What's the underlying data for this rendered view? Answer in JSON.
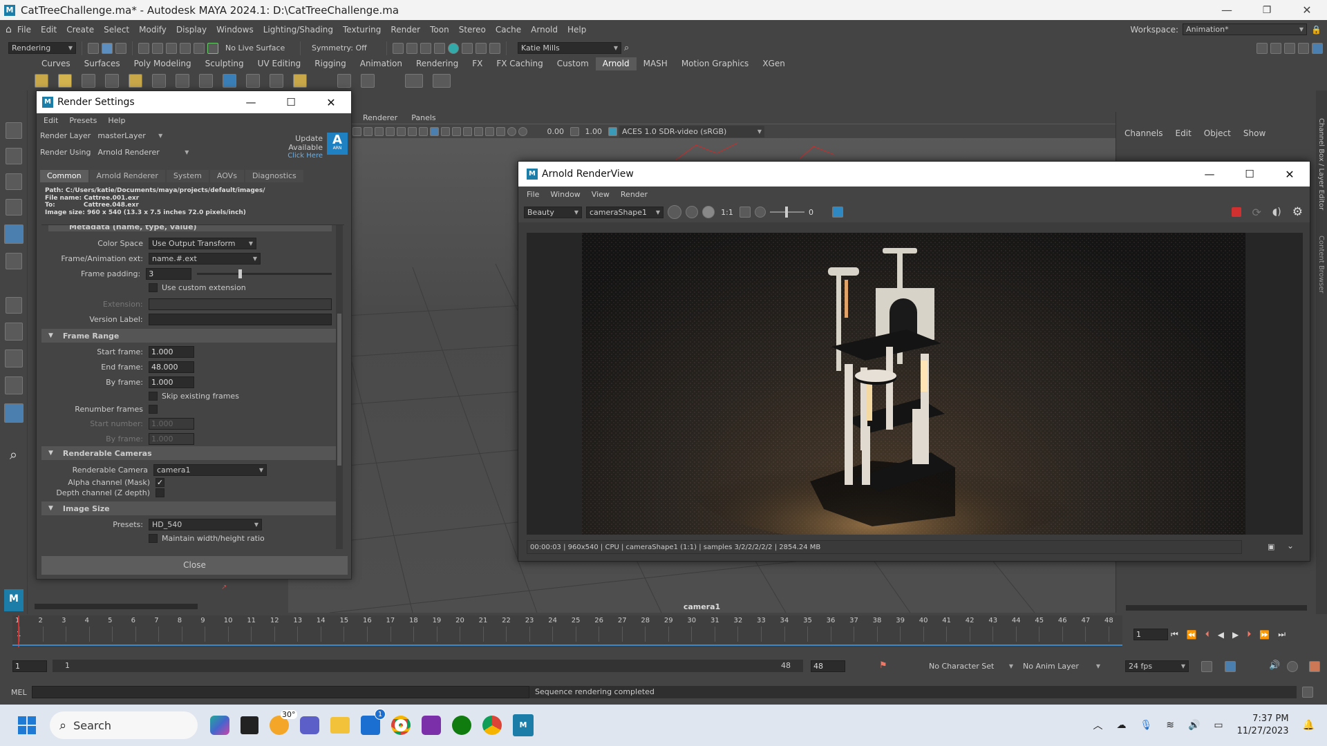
{
  "titlebar": {
    "title": "CatTreeChallenge.ma* - Autodesk MAYA 2024.1: D:\\CatTreeChallenge.ma"
  },
  "menubar": [
    "File",
    "Edit",
    "Create",
    "Select",
    "Modify",
    "Display",
    "Windows",
    "Lighting/Shading",
    "Texturing",
    "Render",
    "Toon",
    "Stereo",
    "Cache",
    "Arnold",
    "Help"
  ],
  "workspace": {
    "label": "Workspace:",
    "value": "Animation*"
  },
  "statusline": {
    "menuset": "Rendering",
    "live_surface": "No Live Surface",
    "symmetry": "Symmetry: Off",
    "user": "Katie Mills"
  },
  "shelf_tabs": [
    "Curves",
    "Surfaces",
    "Poly Modeling",
    "Sculpting",
    "UV Editing",
    "Rigging",
    "Animation",
    "Rendering",
    "FX",
    "FX Caching",
    "Custom",
    "Arnold",
    "MASH",
    "Motion Graphics",
    "XGen"
  ],
  "shelf_active": "Arnold",
  "viewport": {
    "menus": [
      "Renderer",
      "Panels"
    ],
    "val1": "0.00",
    "val2": "1.00",
    "colorspace": "ACES 1.0 SDR-video (sRGB)",
    "camera": "camera1"
  },
  "channelbox": {
    "menus": [
      "Channels",
      "Edit",
      "Object",
      "Show"
    ],
    "side1": "Channel Box / Layer Editor",
    "side2": "Content Browser"
  },
  "render_settings": {
    "title": "Render Settings",
    "menus": [
      "Edit",
      "Presets",
      "Help"
    ],
    "layer_label": "Render Layer",
    "layer": "masterLayer",
    "using_label": "Render Using",
    "using": "Arnold Renderer",
    "update": "Update Available",
    "click": "Click Here",
    "badge": "A",
    "badge_sub": "ARN",
    "tabs": [
      "Common",
      "Arnold Renderer",
      "System",
      "AOVs",
      "Diagnostics"
    ],
    "path": "Path: C:/Users/katie/Documents/maya/projects/default/images/",
    "filename_label": "File name:",
    "filename": "Cattree.001.exr",
    "to_label": "To:",
    "to": "Cattree.048.exr",
    "imagesize": "Image size: 960 x 540 (13.3 x 7.5 inches 72.0 pixels/inch)",
    "metadata": "Metadata (name, type, value)",
    "colorspace_label": "Color Space",
    "colorspace": "Use Output Transform",
    "frameext_label": "Frame/Animation ext:",
    "frameext": "name.#.ext",
    "padding_label": "Frame padding:",
    "padding": "3",
    "custom_ext": "Use custom extension",
    "extension_label": "Extension:",
    "version_label": "Version Label:",
    "frame_range": "Frame Range",
    "start_label": "Start frame:",
    "start": "1.000",
    "end_label": "End frame:",
    "end": "48.000",
    "by_label": "By frame:",
    "by": "1.000",
    "skip": "Skip existing frames",
    "renumber": "Renumber frames",
    "startnum_label": "Start number:",
    "startnum": "1.000",
    "by2_label": "By frame:",
    "by2": "1.000",
    "renderable_cameras": "Renderable Cameras",
    "cam_label": "Renderable Camera",
    "cam": "camera1",
    "alpha": "Alpha channel (Mask)",
    "depth": "Depth channel (Z depth)",
    "image_size": "Image Size",
    "presets_label": "Presets:",
    "presets": "HD_540",
    "maintain": "Maintain width/height ratio",
    "close": "Close"
  },
  "renderview": {
    "title": "Arnold RenderView",
    "menus": [
      "File",
      "Window",
      "View",
      "Render"
    ],
    "aov": "Beauty",
    "camera": "cameraShape1",
    "ratio": "1:1",
    "exposure": "0",
    "status": "00:00:03 | 960x540 | CPU | cameraShape1 (1:1) | samples 3/2/2/2/2/2 | 2854.24 MB"
  },
  "timeline": {
    "ticks": [
      "1",
      "2",
      "3",
      "4",
      "5",
      "6",
      "7",
      "8",
      "9",
      "10",
      "11",
      "12",
      "13",
      "14",
      "15",
      "16",
      "17",
      "18",
      "19",
      "20",
      "21",
      "22",
      "23",
      "24",
      "25",
      "26",
      "27",
      "28",
      "29",
      "30",
      "31",
      "32",
      "33",
      "34",
      "35",
      "36",
      "37",
      "38",
      "39",
      "40",
      "41",
      "42",
      "43",
      "44",
      "45",
      "46",
      "47",
      "48"
    ],
    "current": "1",
    "frame_field": "1"
  },
  "range": {
    "start": "1",
    "inner_start": "1",
    "inner_end": "48",
    "end": "48",
    "char_set": "No Character Set",
    "anim_layer": "No Anim Layer",
    "fps": "24 fps"
  },
  "cmdline": {
    "lang": "MEL",
    "message": "Sequence rendering completed"
  },
  "taskbar": {
    "search": "Search",
    "temp": "30°",
    "badge": "1",
    "time": "7:37 PM",
    "date": "11/27/2023"
  }
}
